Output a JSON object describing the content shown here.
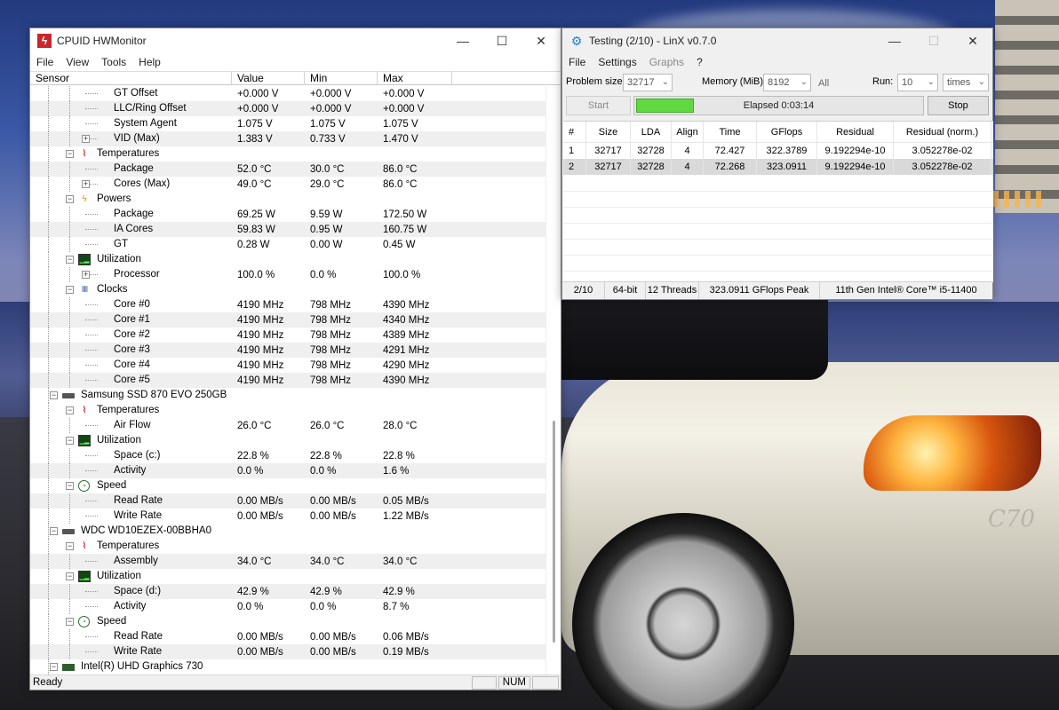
{
  "hwmonitor": {
    "title": "CPUID HWMonitor",
    "menu": [
      "File",
      "View",
      "Tools",
      "Help"
    ],
    "columns": [
      "Sensor",
      "Value",
      "Min",
      "Max"
    ],
    "status": {
      "ready": "Ready",
      "num": "NUM"
    },
    "rows": [
      {
        "kind": "leaf",
        "lvl": 3,
        "name": "GT Offset",
        "value": "+0.000 V",
        "min": "+0.000 V",
        "max": "+0.000 V"
      },
      {
        "kind": "leaf",
        "lvl": 3,
        "name": "LLC/Ring Offset",
        "value": "+0.000 V",
        "min": "+0.000 V",
        "max": "+0.000 V"
      },
      {
        "kind": "leaf",
        "lvl": 3,
        "name": "System Agent",
        "value": "1.075 V",
        "min": "1.075 V",
        "max": "1.075 V"
      },
      {
        "kind": "leaf",
        "lvl": 3,
        "name": "VID (Max)",
        "value": "1.383 V",
        "min": "0.733 V",
        "max": "1.470 V",
        "expand": "+"
      },
      {
        "kind": "group",
        "lvl": 2,
        "icon": "temperature-icon",
        "name": "Temperatures"
      },
      {
        "kind": "leaf",
        "lvl": 3,
        "name": "Package",
        "value": "52.0 °C",
        "min": "30.0 °C",
        "max": "86.0 °C"
      },
      {
        "kind": "leaf",
        "lvl": 3,
        "name": "Cores (Max)",
        "value": "49.0 °C",
        "min": "29.0 °C",
        "max": "86.0 °C",
        "expand": "+"
      },
      {
        "kind": "group",
        "lvl": 2,
        "icon": "power-icon",
        "name": "Powers"
      },
      {
        "kind": "leaf",
        "lvl": 3,
        "name": "Package",
        "value": "69.25 W",
        "min": "9.59 W",
        "max": "172.50 W"
      },
      {
        "kind": "leaf",
        "lvl": 3,
        "name": "IA Cores",
        "value": "59.83 W",
        "min": "0.95 W",
        "max": "160.75 W"
      },
      {
        "kind": "leaf",
        "lvl": 3,
        "name": "GT",
        "value": "0.28 W",
        "min": "0.00 W",
        "max": "0.45 W"
      },
      {
        "kind": "group",
        "lvl": 2,
        "icon": "utilization-icon",
        "name": "Utilization"
      },
      {
        "kind": "leaf",
        "lvl": 3,
        "name": "Processor",
        "value": "100.0 %",
        "min": "0.0 %",
        "max": "100.0 %",
        "expand": "+"
      },
      {
        "kind": "group",
        "lvl": 2,
        "icon": "clock-icon",
        "name": "Clocks"
      },
      {
        "kind": "leaf",
        "lvl": 3,
        "name": "Core #0",
        "value": "4190 MHz",
        "min": "798 MHz",
        "max": "4390 MHz"
      },
      {
        "kind": "leaf",
        "lvl": 3,
        "name": "Core #1",
        "value": "4190 MHz",
        "min": "798 MHz",
        "max": "4340 MHz"
      },
      {
        "kind": "leaf",
        "lvl": 3,
        "name": "Core #2",
        "value": "4190 MHz",
        "min": "798 MHz",
        "max": "4389 MHz"
      },
      {
        "kind": "leaf",
        "lvl": 3,
        "name": "Core #3",
        "value": "4190 MHz",
        "min": "798 MHz",
        "max": "4291 MHz"
      },
      {
        "kind": "leaf",
        "lvl": 3,
        "name": "Core #4",
        "value": "4190 MHz",
        "min": "798 MHz",
        "max": "4290 MHz"
      },
      {
        "kind": "leaf",
        "lvl": 3,
        "name": "Core #5",
        "value": "4190 MHz",
        "min": "798 MHz",
        "max": "4390 MHz"
      },
      {
        "kind": "device",
        "lvl": 1,
        "icon": "drive-icon",
        "name": "Samsung SSD 870 EVO 250GB"
      },
      {
        "kind": "group",
        "lvl": 2,
        "icon": "temperature-icon",
        "name": "Temperatures"
      },
      {
        "kind": "leaf",
        "lvl": 3,
        "name": "Air Flow",
        "value": "26.0 °C",
        "min": "26.0 °C",
        "max": "28.0 °C"
      },
      {
        "kind": "group",
        "lvl": 2,
        "icon": "utilization-icon",
        "name": "Utilization"
      },
      {
        "kind": "leaf",
        "lvl": 3,
        "name": "Space (c:)",
        "value": "22.8 %",
        "min": "22.8 %",
        "max": "22.8 %"
      },
      {
        "kind": "leaf",
        "lvl": 3,
        "name": "Activity",
        "value": "0.0 %",
        "min": "0.0 %",
        "max": "1.6 %"
      },
      {
        "kind": "group",
        "lvl": 2,
        "icon": "speed-icon",
        "name": "Speed"
      },
      {
        "kind": "leaf",
        "lvl": 3,
        "name": "Read Rate",
        "value": "0.00 MB/s",
        "min": "0.00 MB/s",
        "max": "0.05 MB/s"
      },
      {
        "kind": "leaf",
        "lvl": 3,
        "name": "Write Rate",
        "value": "0.00 MB/s",
        "min": "0.00 MB/s",
        "max": "1.22 MB/s"
      },
      {
        "kind": "device",
        "lvl": 1,
        "icon": "drive-icon",
        "name": "WDC WD10EZEX-00BBHA0"
      },
      {
        "kind": "group",
        "lvl": 2,
        "icon": "temperature-icon",
        "name": "Temperatures"
      },
      {
        "kind": "leaf",
        "lvl": 3,
        "name": "Assembly",
        "value": "34.0 °C",
        "min": "34.0 °C",
        "max": "34.0 °C"
      },
      {
        "kind": "group",
        "lvl": 2,
        "icon": "utilization-icon",
        "name": "Utilization"
      },
      {
        "kind": "leaf",
        "lvl": 3,
        "name": "Space (d:)",
        "value": "42.9 %",
        "min": "42.9 %",
        "max": "42.9 %"
      },
      {
        "kind": "leaf",
        "lvl": 3,
        "name": "Activity",
        "value": "0.0 %",
        "min": "0.0 %",
        "max": "8.7 %"
      },
      {
        "kind": "group",
        "lvl": 2,
        "icon": "speed-icon",
        "name": "Speed"
      },
      {
        "kind": "leaf",
        "lvl": 3,
        "name": "Read Rate",
        "value": "0.00 MB/s",
        "min": "0.00 MB/s",
        "max": "0.06 MB/s"
      },
      {
        "kind": "leaf",
        "lvl": 3,
        "name": "Write Rate",
        "value": "0.00 MB/s",
        "min": "0.00 MB/s",
        "max": "0.19 MB/s"
      },
      {
        "kind": "device",
        "lvl": 1,
        "icon": "gpu-icon",
        "name": "Intel(R) UHD Graphics 730"
      }
    ]
  },
  "linx": {
    "title": "Testing (2/10) - LinX v0.7.0",
    "menu": [
      {
        "label": "File",
        "enabled": true
      },
      {
        "label": "Settings",
        "enabled": true
      },
      {
        "label": "Graphs",
        "enabled": false
      },
      {
        "label": "?",
        "enabled": true
      }
    ],
    "params": {
      "problem_size_label": "Problem size:",
      "problem_size": "32717",
      "memory_label": "Memory (MiB):",
      "memory": "8192",
      "all_label": "All",
      "run_label": "Run:",
      "run": "10",
      "times": "times"
    },
    "start_label": "Start",
    "stop_label": "Stop",
    "elapsed": "Elapsed 0:03:14",
    "progress": 0.2,
    "columns": [
      "#",
      "Size",
      "LDA",
      "Align",
      "Time",
      "GFlops",
      "Residual",
      "Residual (norm.)"
    ],
    "rows": [
      [
        "1",
        "32717",
        "32728",
        "4",
        "72.427",
        "322.3789",
        "9.192294e-10",
        "3.052278e-02"
      ],
      [
        "2",
        "32717",
        "32728",
        "4",
        "72.268",
        "323.0911",
        "9.192294e-10",
        "3.052278e-02"
      ]
    ],
    "status": [
      "2/10",
      "64-bit",
      "12 Threads",
      "323.0911 GFlops Peak",
      "11th Gen Intel® Core™ i5-11400"
    ]
  },
  "window_controls": {
    "minimize": "—",
    "maximize": "☐",
    "close": "✕"
  }
}
